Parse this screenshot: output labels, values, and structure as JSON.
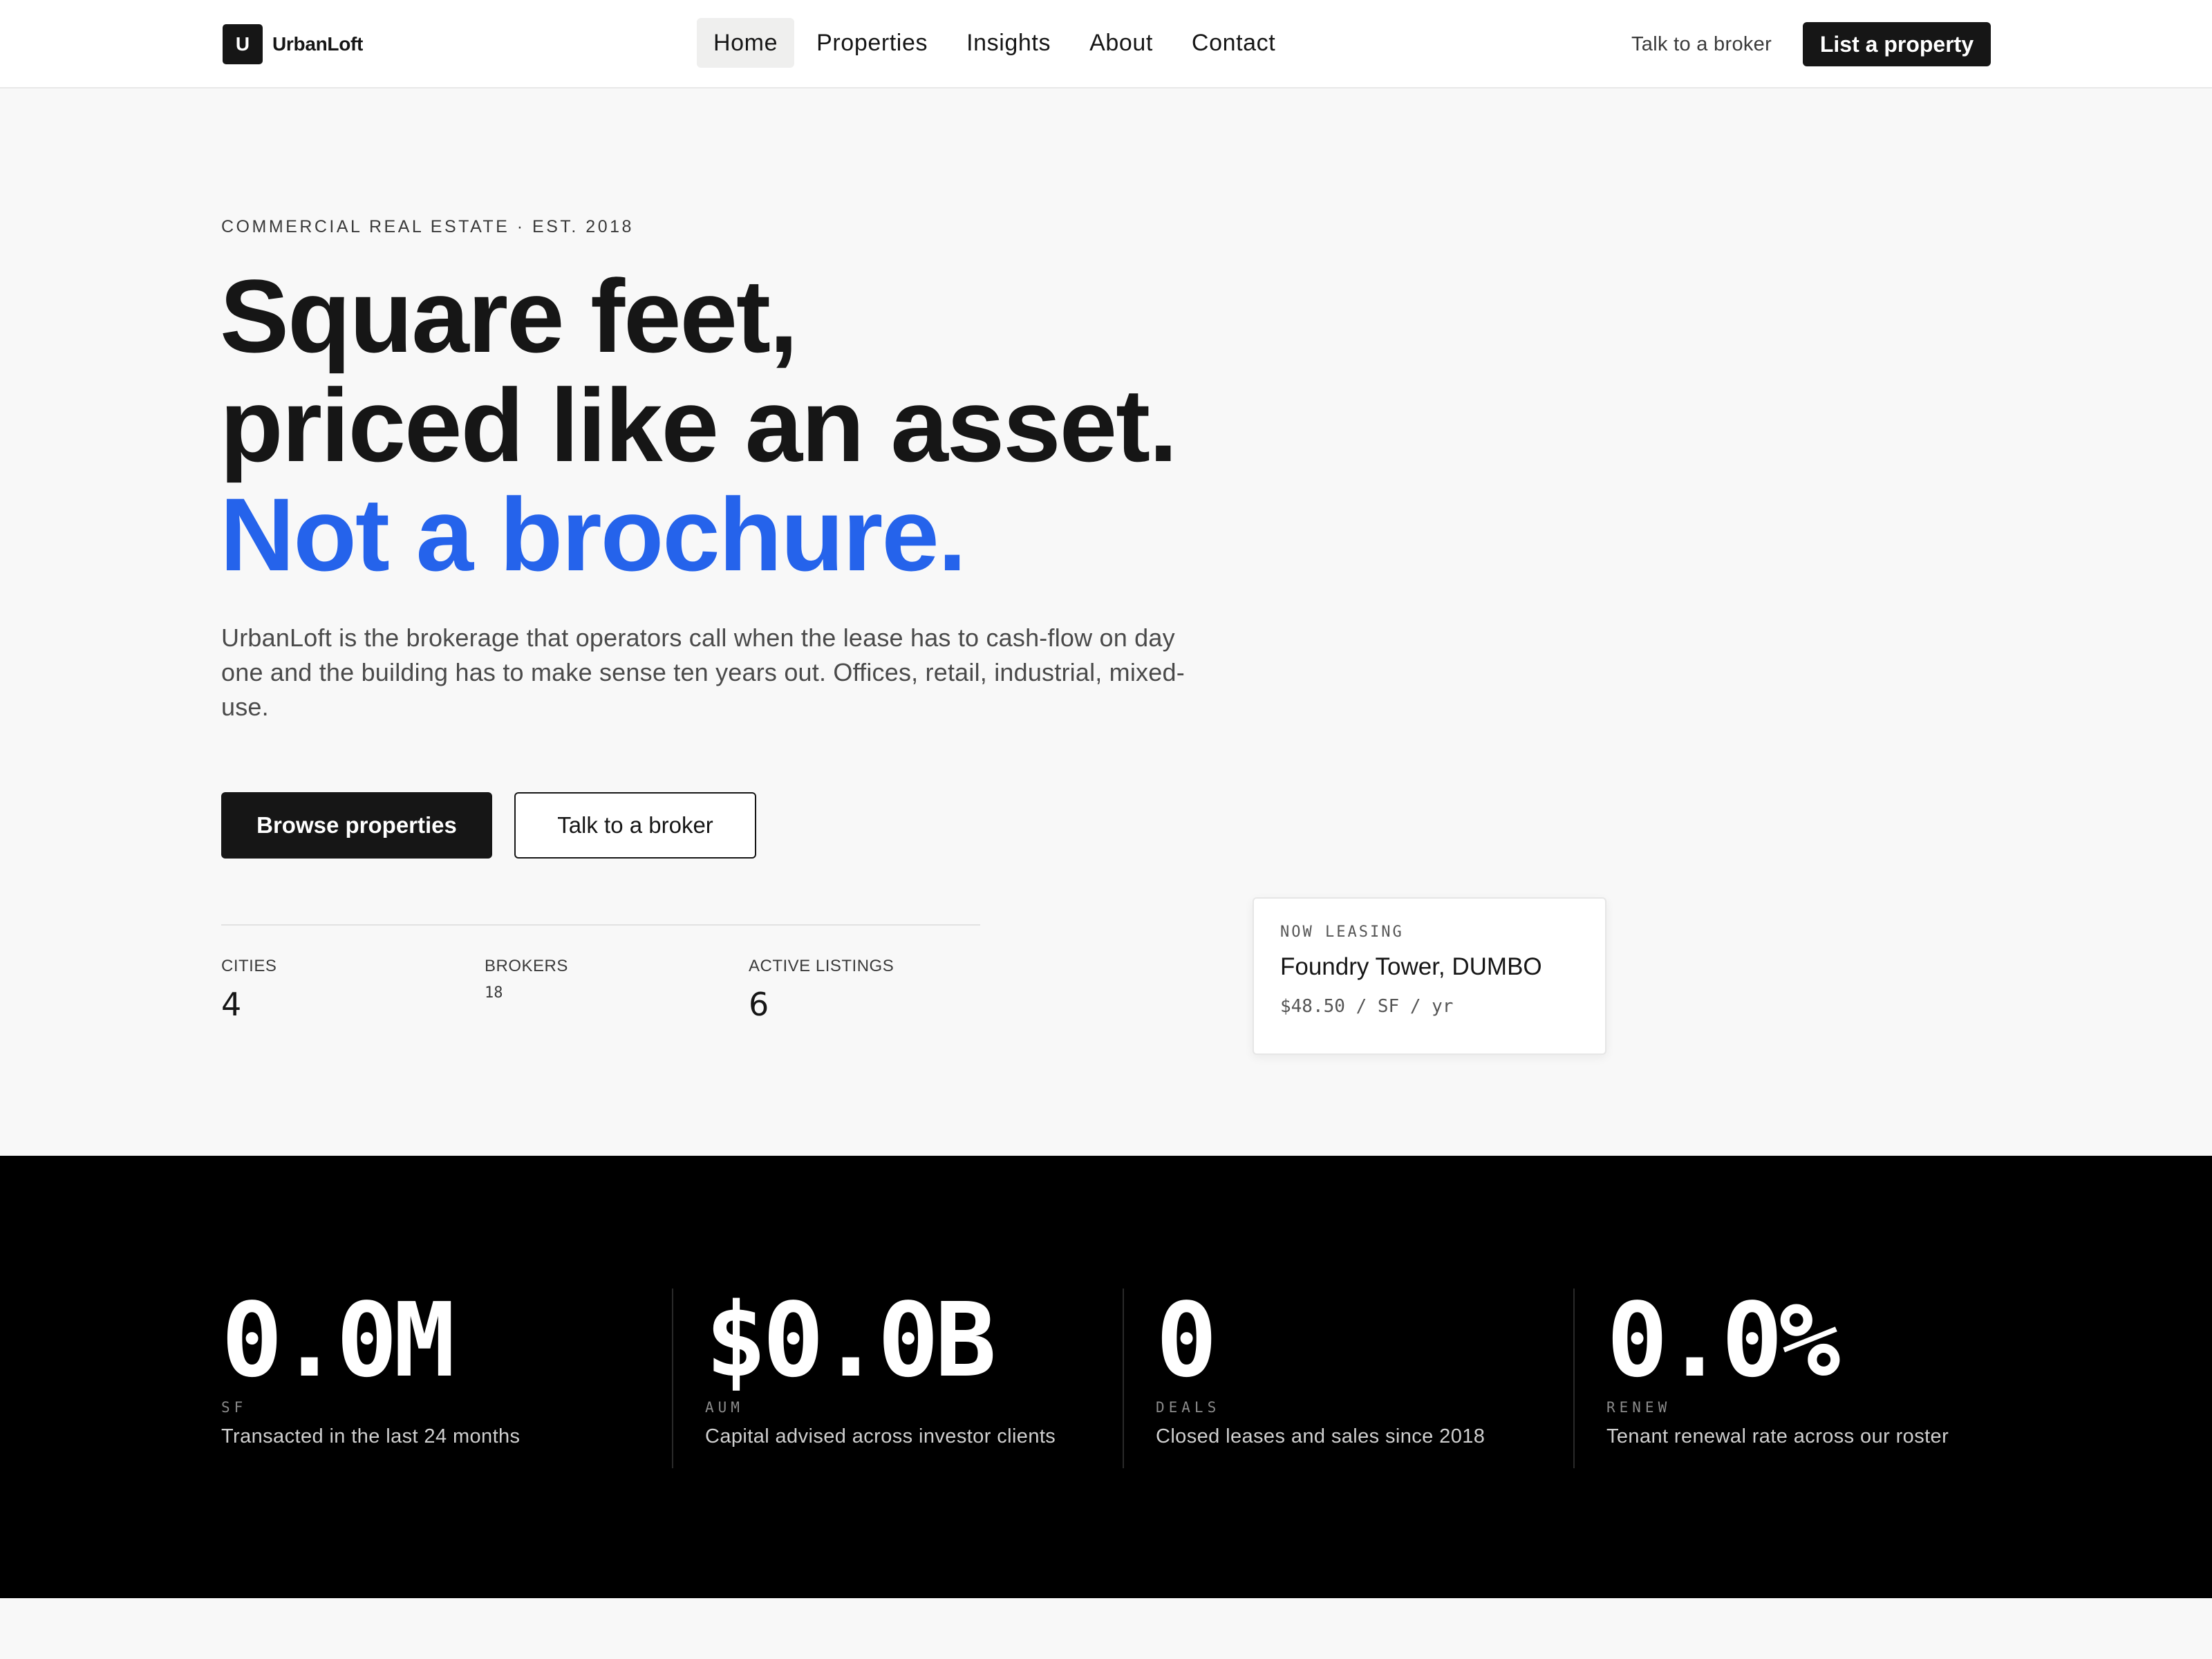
{
  "header": {
    "logo_mark": "U",
    "logo_text": "UrbanLoft",
    "nav": [
      {
        "label": "Home",
        "active": true
      },
      {
        "label": "Properties"
      },
      {
        "label": "Insights"
      },
      {
        "label": "About"
      },
      {
        "label": "Contact"
      }
    ],
    "secondary_link": "Talk to a broker",
    "cta_label": "List a property"
  },
  "hero": {
    "eyebrow": "COMMERCIAL REAL ESTATE · EST. 2018",
    "title_line1": "Square feet,",
    "title_line2": "priced like an asset.",
    "title_line3": "Not a brochure.",
    "description": "UrbanLoft is the brokerage that operators call when the lease has to cash-flow on day one and the building has to make sense ten years out. Offices, retail, industrial, mixed-use.",
    "primary_button": "Browse properties",
    "secondary_button": "Talk to a broker",
    "stats": [
      {
        "label": "CITIES",
        "value": "4"
      },
      {
        "label": "BROKERS",
        "value": "18"
      },
      {
        "label": "ACTIVE LISTINGS",
        "value": "6"
      }
    ]
  },
  "lease_card": {
    "tag": "NOW LEASING",
    "name": "Foundry Tower, DUMBO",
    "price": "$48.50 / SF / yr"
  },
  "metrics": [
    {
      "value": "0.0M",
      "code": "SF",
      "description": "Transacted in the last 24 months"
    },
    {
      "value": "$0.0B",
      "code": "AUM",
      "description": "Capital advised across investor clients"
    },
    {
      "value": "0",
      "code": "DEALS",
      "description": "Closed leases and sales since 2018"
    },
    {
      "value": "0.0%",
      "code": "RENEW",
      "description": "Tenant renewal rate across our roster"
    }
  ],
  "colors": {
    "accent": "#2563eb",
    "ink": "#161616",
    "band": "#000000",
    "background": "#f8f8f8"
  }
}
